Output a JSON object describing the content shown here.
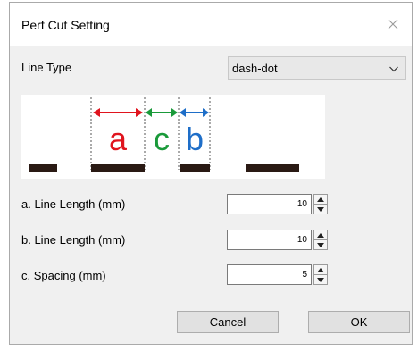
{
  "dialog": {
    "title": "Perf Cut Setting"
  },
  "line_type": {
    "label": "Line Type",
    "selected": "dash-dot"
  },
  "preview": {
    "letter_a": "a",
    "letter_c": "c",
    "letter_b": "b",
    "colors": {
      "a": "#e0141e",
      "c": "#1a9a3a",
      "b": "#1e6ec8",
      "dash": "#2a1a14"
    }
  },
  "fields": [
    {
      "label": "a. Line Length (mm)",
      "value": "10"
    },
    {
      "label": "b. Line Length (mm)",
      "value": "10"
    },
    {
      "label": "c. Spacing (mm)",
      "value": "5"
    }
  ],
  "buttons": {
    "cancel": "Cancel",
    "ok": "OK"
  },
  "icons": {
    "close": "close-icon",
    "dropdown": "chevron-down-icon",
    "spin_up": "spin-up-icon",
    "spin_down": "spin-down-icon"
  }
}
